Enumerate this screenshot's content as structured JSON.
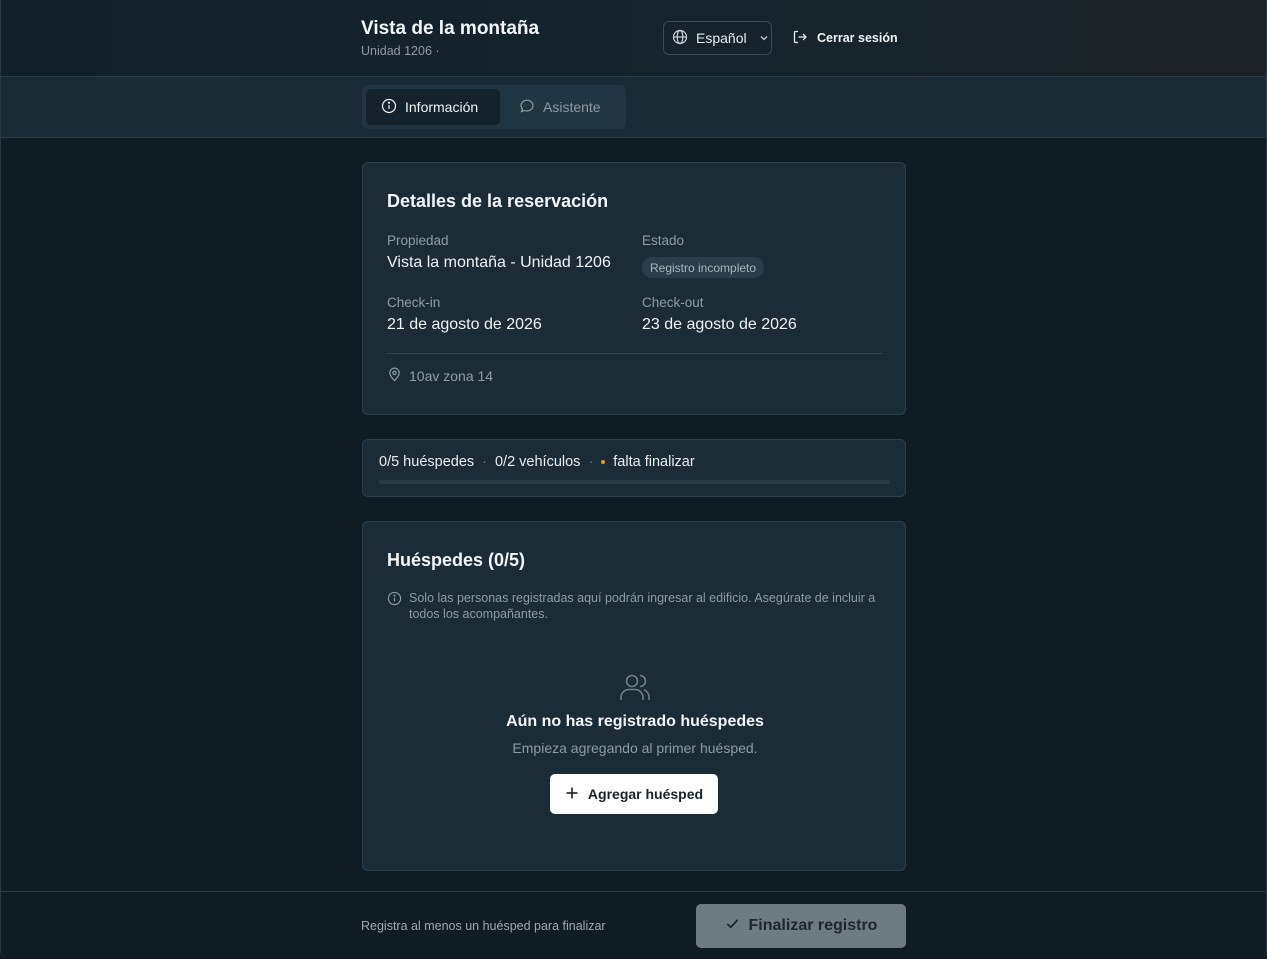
{
  "header": {
    "title": "Vista de la montaña",
    "subtitle": "Unidad 1206 ·",
    "language_label": "Español",
    "logout_label": "Cerrar sesión"
  },
  "tabs": [
    {
      "label": "Información",
      "active": true
    },
    {
      "label": "Asistente",
      "active": false
    }
  ],
  "reservation": {
    "title": "Detalles de la reservación",
    "property_label": "Propiedad",
    "property_value": "Vista la montaña - Unidad 1206",
    "status_label": "Estado",
    "status_value": "Registro incompleto",
    "checkin_label": "Check-in",
    "checkin_value": "21 de agosto de 2026",
    "checkout_label": "Check-out",
    "checkout_value": "23 de agosto de 2026",
    "address": "10av zona 14"
  },
  "progress": {
    "guests": "0/5 huéspedes",
    "vehicles": "0/2 vehículos",
    "status": "falta finalizar",
    "fraction": 0,
    "separator": "·"
  },
  "guests": {
    "title": "Huéspedes (0/5)",
    "note": "Solo las personas registradas aquí podrán ingresar al edificio. Asegúrate de incluir a todos los acompañantes.",
    "empty_title": "Aún no has registrado huéspedes",
    "empty_subtitle": "Empieza agregando al primer huésped.",
    "add_button": "Agregar huésped"
  },
  "footer": {
    "hint": "Registra al menos un huésped para finalizar",
    "finish_button": "Finalizar registro"
  },
  "icons": {
    "language": "globe-icon",
    "logout": "logout-icon",
    "info_tab": "info-icon",
    "assistant_tab": "chat-bubble-icon",
    "address": "map-pin-icon",
    "empty": "users-icon",
    "add": "plus-icon",
    "finish": "check-icon"
  },
  "colors": {
    "background": "#0f1c24",
    "card": "#1b2c37",
    "pending_dot": "#e8933a",
    "disabled_button": "#6f7b82"
  }
}
